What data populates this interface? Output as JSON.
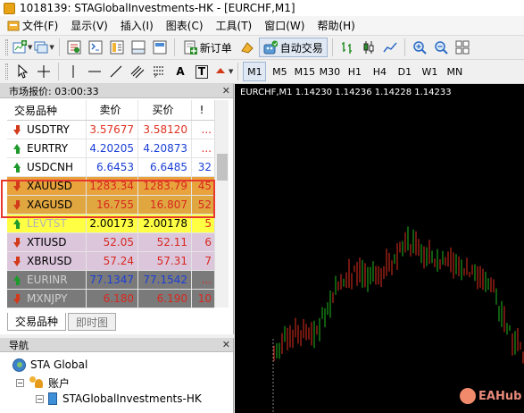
{
  "window": {
    "title": "1018139: STAGlobalInvestments-HK - [EURCHF,M1]"
  },
  "menu": [
    {
      "label": "文件(F)",
      "icon": "app-menu-icon"
    },
    {
      "label": "显示(V)"
    },
    {
      "label": "插入(I)"
    },
    {
      "label": "图表(C)"
    },
    {
      "label": "工具(T)"
    },
    {
      "label": "窗口(W)"
    },
    {
      "label": "帮助(H)"
    }
  ],
  "toolbar1": {
    "new_order_label": "新订单",
    "auto_trade_label": "自动交易"
  },
  "toolbar2": {
    "text_tool": "A",
    "text_label_tool": "T",
    "timeframes": [
      "M1",
      "M5",
      "M15",
      "M30",
      "H1",
      "H4",
      "D1",
      "W1",
      "MN"
    ],
    "active_timeframe": "M1"
  },
  "market_watch": {
    "header": "市场报价: 03:00:33",
    "columns": {
      "symbol": "交易品种",
      "bid": "卖价",
      "ask": "买价",
      "spread": "!"
    },
    "rows": [
      {
        "symbol": "USDTRY",
        "dir": "down",
        "bid": "3.57677",
        "ask": "3.58120",
        "spread": "...",
        "bg": "#ffffff",
        "sym_color": "#000000",
        "price_color": "#e03020"
      },
      {
        "symbol": "EURTRY",
        "dir": "up",
        "bid": "4.20205",
        "ask": "4.20873",
        "spread": "...",
        "bg": "#ffffff",
        "sym_color": "#000000",
        "price_color": "#1a3fd6"
      },
      {
        "symbol": "USDCNH",
        "dir": "up",
        "bid": "6.6453",
        "ask": "6.6485",
        "spread": "32",
        "bg": "#ffffff",
        "sym_color": "#000000",
        "price_color": "#1a3fd6"
      },
      {
        "symbol": "XAUUSD",
        "dir": "down",
        "bid": "1283.34",
        "ask": "1283.79",
        "spread": "45",
        "bg": "#e8a33c",
        "sym_color": "#000000",
        "price_color": "#d8281e"
      },
      {
        "symbol": "XAGUSD",
        "dir": "down",
        "bid": "16.755",
        "ask": "16.807",
        "spread": "52",
        "bg": "#e0a640",
        "sym_color": "#000000",
        "price_color": "#d8281e"
      },
      {
        "symbol": "LEVTST",
        "dir": "up",
        "bid": "2.00173",
        "ask": "2.00178",
        "spread": "5",
        "bg": "#ffff44",
        "sym_color": "#b4b4b4",
        "price_color": "#000000"
      },
      {
        "symbol": "XTIUSD",
        "dir": "down",
        "bid": "52.05",
        "ask": "52.11",
        "spread": "6",
        "bg": "#dcc6dc",
        "sym_color": "#000000",
        "price_color": "#d8281e"
      },
      {
        "symbol": "XBRUSD",
        "dir": "down",
        "bid": "57.24",
        "ask": "57.31",
        "spread": "7",
        "bg": "#dcc6dc",
        "sym_color": "#000000",
        "price_color": "#d8281e"
      },
      {
        "symbol": "EURINR",
        "dir": "up",
        "bid": "77.1347",
        "ask": "77.1542",
        "spread": "...",
        "bg": "#7a7a7a",
        "sym_color": "#d0d0d0",
        "price_color": "#1a3fd6"
      },
      {
        "symbol": "MXNJPY",
        "dir": "down",
        "bid": "6.180",
        "ask": "6.190",
        "spread": "10",
        "bg": "#7a7a7a",
        "sym_color": "#d0d0d0",
        "price_color": "#d8281e"
      }
    ],
    "tabs": [
      "交易品种",
      "即时图"
    ]
  },
  "navigator": {
    "header": "导航",
    "root": "STA Global",
    "accounts": "账户",
    "account_name": "STAGlobalInvestments-HK"
  },
  "chart": {
    "header": "EURCHF,M1  1.14230 1.14236 1.14228 1.14233"
  },
  "watermark": {
    "text": "EAHub"
  },
  "colors": {
    "bull": "#1fb81f",
    "bear": "#e03020",
    "chart_bg": "#000000",
    "highlight": "#e8382c"
  }
}
